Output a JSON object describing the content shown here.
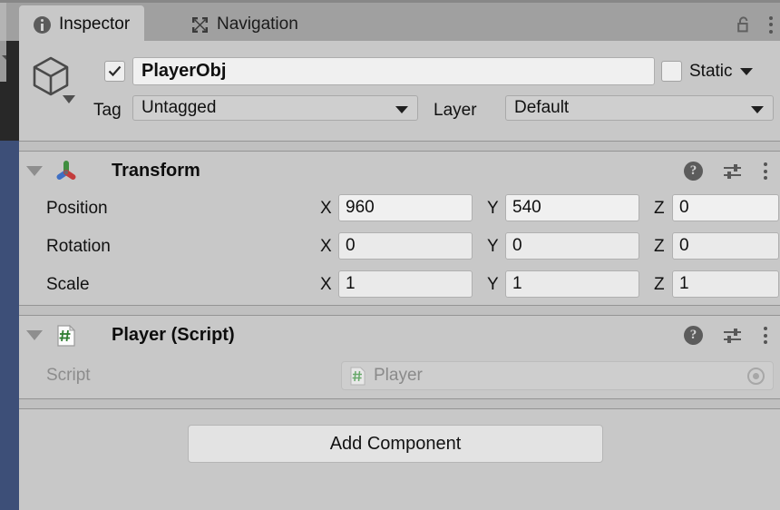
{
  "window": {
    "tabs": [
      {
        "label": "Inspector",
        "icon": "info-icon",
        "active": true
      },
      {
        "label": "Navigation",
        "icon": "move-arrows-icon",
        "active": false
      }
    ],
    "lock_icon": "unlocked-padlock-icon",
    "menu_icon": "kebab-menu-icon"
  },
  "object_header": {
    "prefab_icon": "cube-icon",
    "enabled_checkbox": "checked",
    "name": "PlayerObj",
    "static_label": "Static",
    "static_checkbox": "unchecked",
    "tag_label": "Tag",
    "tag_value": "Untagged",
    "layer_label": "Layer",
    "layer_value": "Default"
  },
  "components": [
    {
      "title": "Transform",
      "icon": "transform-gizmo-icon",
      "expanded": true,
      "rows": [
        {
          "label": "Position",
          "x": "960",
          "y": "540",
          "z": "0"
        },
        {
          "label": "Rotation",
          "x": "0",
          "y": "0",
          "z": "0"
        },
        {
          "label": "Scale",
          "x": "1",
          "y": "1",
          "z": "1"
        }
      ],
      "axis_labels": {
        "x": "X",
        "y": "Y",
        "z": "Z"
      }
    },
    {
      "title": "Player (Script)",
      "icon": "csharp-script-icon",
      "expanded": true,
      "script_label": "Script",
      "script_value": "Player",
      "script_icon": "csharp-script-icon",
      "picker_icon": "object-picker-icon"
    }
  ],
  "header_icons": {
    "help": "?",
    "help_name": "help-icon",
    "preset": "preset-sliders-icon",
    "menu": "kebab-menu-icon"
  },
  "footer": {
    "add_component": "Add Component"
  },
  "colors": {
    "panel_bg": "#c8c8c8",
    "tabbar_bg": "#a0a0a0",
    "rail_blue": "#3d4f78",
    "rail_dark": "#282828",
    "field_bg": "#eaeaea",
    "axis_x": "#c02a2a",
    "axis_y": "#2e8b2e",
    "axis_z": "#3470c0"
  }
}
